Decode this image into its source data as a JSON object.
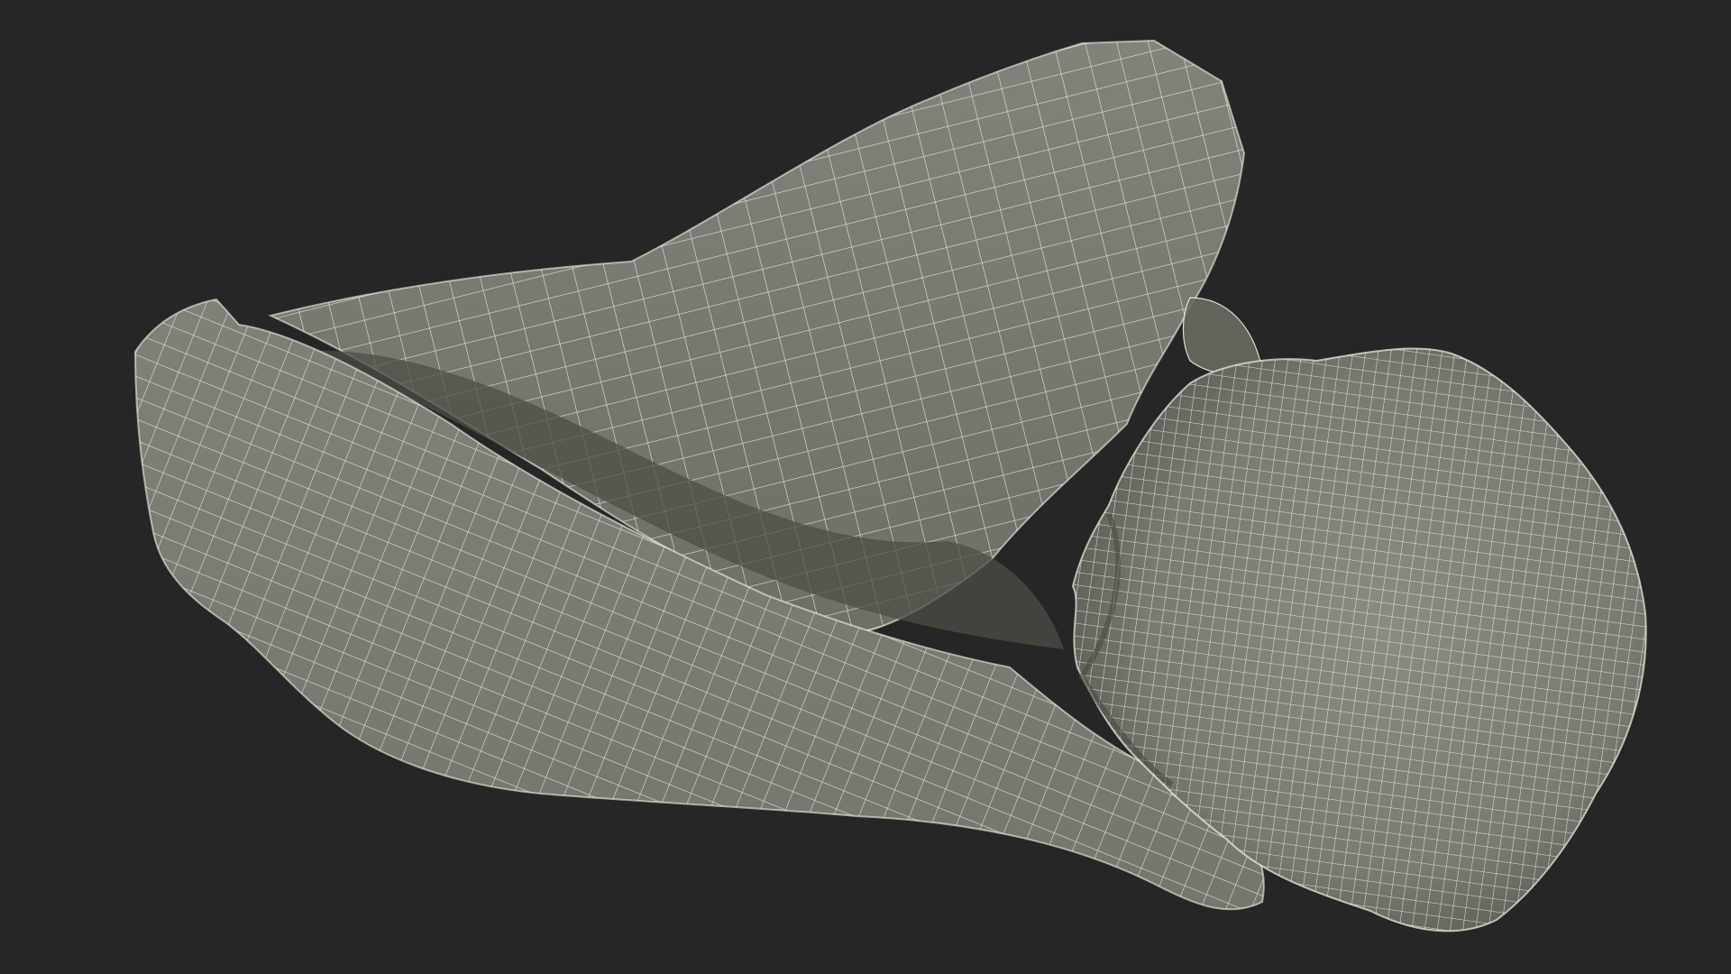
{
  "scene": {
    "background_color": "#262626",
    "surface_color": "#7a7a70",
    "surface_shadow_color": "#50504a",
    "surface_highlight_color": "#8a8a80",
    "wire_color": "#f2f0e4",
    "render_mode": "wireframe-on-shaded",
    "subject": "bone-mesh"
  }
}
